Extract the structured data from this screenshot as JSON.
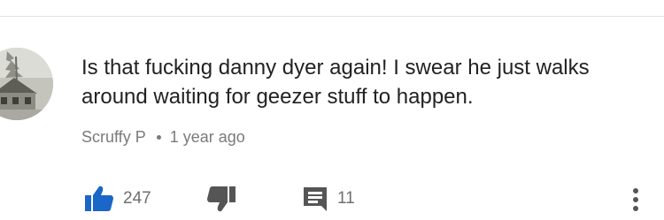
{
  "comment": {
    "text": "Is that fucking danny dyer again! I swear he just walks around waiting for geezer stuff to happen.",
    "author": "Scruffy P",
    "timestamp": "1 year ago"
  },
  "actions": {
    "like_count": "247",
    "reply_count": "11"
  },
  "icons": {
    "like": "thumbs-up-icon",
    "dislike": "thumbs-down-icon",
    "reply": "comment-icon",
    "more": "more-vertical-icon"
  },
  "colors": {
    "like_active": "#1a66c9",
    "icon_dark": "#555555",
    "text": "#222222",
    "meta": "#7a7a7a"
  }
}
